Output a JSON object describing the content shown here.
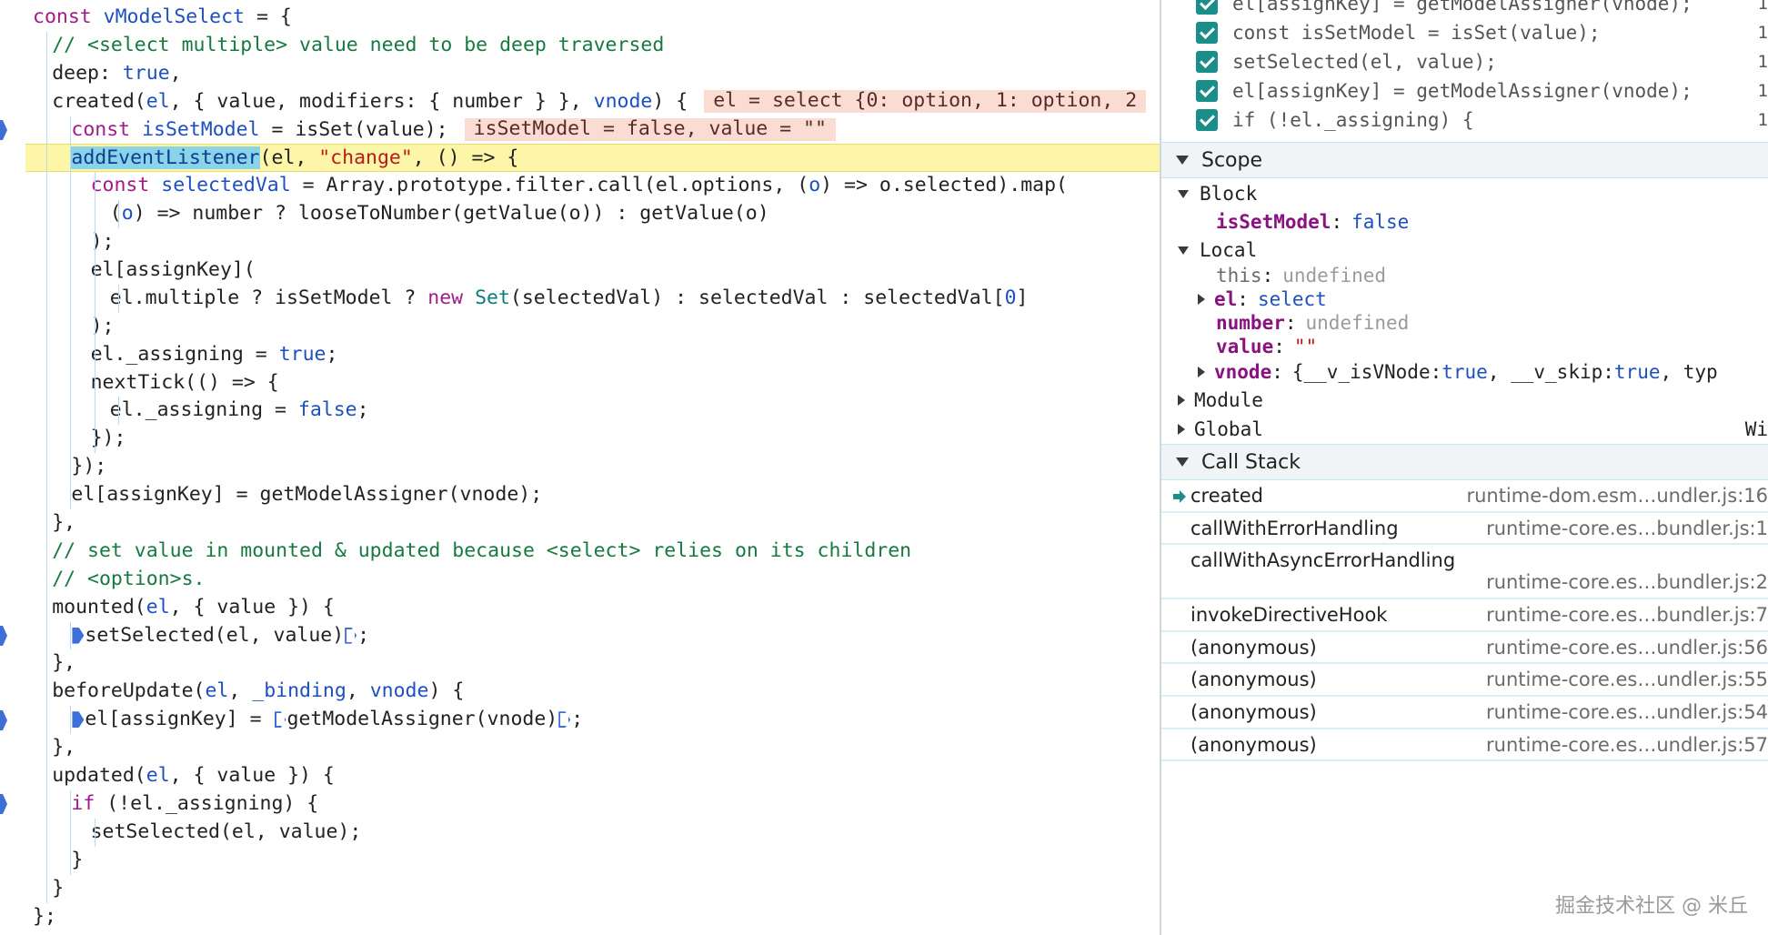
{
  "editor": {
    "lines": [
      {
        "indent": 0,
        "tokens": [
          {
            "t": "const ",
            "c": "kw"
          },
          {
            "t": "vModelSelect",
            "c": "param"
          },
          {
            "t": " = {",
            "c": "plain"
          }
        ]
      },
      {
        "indent": 1,
        "tokens": [
          {
            "t": "// <select multiple> value need to be deep traversed",
            "c": "comment"
          }
        ]
      },
      {
        "indent": 1,
        "tokens": [
          {
            "t": "deep: ",
            "c": "plain"
          },
          {
            "t": "true",
            "c": "lit"
          },
          {
            "t": ",",
            "c": "plain"
          }
        ]
      },
      {
        "indent": 1,
        "tokens": [
          {
            "t": "created(",
            "c": "plain"
          },
          {
            "t": "el",
            "c": "param"
          },
          {
            "t": ", { value, modifiers: { number } }, ",
            "c": "plain"
          },
          {
            "t": "vnode",
            "c": "param"
          },
          {
            "t": ") {",
            "c": "plain"
          }
        ],
        "inline": "el = select {0: option, 1: option, 2"
      },
      {
        "indent": 2,
        "tokens": [
          {
            "t": "const ",
            "c": "kw"
          },
          {
            "t": "isSetModel",
            "c": "param"
          },
          {
            "t": " = isSet(value);",
            "c": "plain"
          }
        ],
        "inline": "isSetModel = false, value = \"\""
      },
      {
        "indent": 2,
        "paused": true,
        "tokens": [
          {
            "t": "addEventListener",
            "c": "highlight"
          },
          {
            "t": "(el, ",
            "c": "plain"
          },
          {
            "t": "\"change\"",
            "c": "string"
          },
          {
            "t": ", () => {",
            "c": "plain"
          }
        ]
      },
      {
        "indent": 3,
        "tokens": [
          {
            "t": "const ",
            "c": "kw"
          },
          {
            "t": "selectedVal",
            "c": "param"
          },
          {
            "t": " = Array.prototype.filter.call(el.options, (",
            "c": "plain"
          },
          {
            "t": "o",
            "c": "param"
          },
          {
            "t": ") => o.selected).map(",
            "c": "plain"
          }
        ]
      },
      {
        "indent": 4,
        "tokens": [
          {
            "t": "(",
            "c": "plain"
          },
          {
            "t": "o",
            "c": "param"
          },
          {
            "t": ") => number ? looseToNumber(getValue(o)) : getValue(o)",
            "c": "plain"
          }
        ]
      },
      {
        "indent": 3,
        "tokens": [
          {
            "t": ");",
            "c": "plain"
          }
        ]
      },
      {
        "indent": 3,
        "tokens": [
          {
            "t": "el[assignKey](",
            "c": "plain"
          }
        ]
      },
      {
        "indent": 4,
        "tokens": [
          {
            "t": "el.multiple ? isSetModel ? ",
            "c": "plain"
          },
          {
            "t": "new ",
            "c": "kw"
          },
          {
            "t": "Set",
            "c": "cls"
          },
          {
            "t": "(selectedVal) : selectedVal : selectedVal[",
            "c": "plain"
          },
          {
            "t": "0",
            "c": "lit"
          },
          {
            "t": "]",
            "c": "plain"
          }
        ]
      },
      {
        "indent": 3,
        "tokens": [
          {
            "t": ");",
            "c": "plain"
          }
        ]
      },
      {
        "indent": 3,
        "tokens": [
          {
            "t": "el._assigning = ",
            "c": "plain"
          },
          {
            "t": "true",
            "c": "lit"
          },
          {
            "t": ";",
            "c": "plain"
          }
        ]
      },
      {
        "indent": 3,
        "tokens": [
          {
            "t": "nextTick(() => {",
            "c": "plain"
          }
        ]
      },
      {
        "indent": 4,
        "tokens": [
          {
            "t": "el._assigning = ",
            "c": "plain"
          },
          {
            "t": "false",
            "c": "lit"
          },
          {
            "t": ";",
            "c": "plain"
          }
        ]
      },
      {
        "indent": 3,
        "tokens": [
          {
            "t": "});",
            "c": "plain"
          }
        ]
      },
      {
        "indent": 2,
        "tokens": [
          {
            "t": "});",
            "c": "plain"
          }
        ]
      },
      {
        "indent": 2,
        "tokens": [
          {
            "t": "el[assignKey] = getModelAssigner(vnode);",
            "c": "plain"
          }
        ]
      },
      {
        "indent": 1,
        "tokens": [
          {
            "t": "},",
            "c": "plain"
          }
        ]
      },
      {
        "indent": 1,
        "tokens": [
          {
            "t": "// set value in mounted & updated because <select> relies on its children",
            "c": "comment"
          }
        ]
      },
      {
        "indent": 1,
        "tokens": [
          {
            "t": "// <option>s.",
            "c": "comment"
          }
        ]
      },
      {
        "indent": 1,
        "tokens": [
          {
            "t": "mounted(",
            "c": "plain"
          },
          {
            "t": "el",
            "c": "param"
          },
          {
            "t": ", { value }) {",
            "c": "plain"
          }
        ]
      },
      {
        "indent": 2,
        "tokens": [
          {
            "t": "",
            "c": "bpsolid"
          },
          {
            "t": "setSelected(el, value)",
            "c": "plain"
          },
          {
            "t": "",
            "c": "bpoutline"
          },
          {
            "t": ";",
            "c": "plain"
          }
        ]
      },
      {
        "indent": 1,
        "tokens": [
          {
            "t": "},",
            "c": "plain"
          }
        ]
      },
      {
        "indent": 1,
        "tokens": [
          {
            "t": "beforeUpdate(",
            "c": "plain"
          },
          {
            "t": "el",
            "c": "param"
          },
          {
            "t": ", ",
            "c": "plain"
          },
          {
            "t": "_binding",
            "c": "param"
          },
          {
            "t": ", ",
            "c": "plain"
          },
          {
            "t": "vnode",
            "c": "param"
          },
          {
            "t": ") {",
            "c": "plain"
          }
        ]
      },
      {
        "indent": 2,
        "tokens": [
          {
            "t": "",
            "c": "bpsolid"
          },
          {
            "t": "el[assignKey] = ",
            "c": "plain"
          },
          {
            "t": "",
            "c": "bpoutline"
          },
          {
            "t": "getModelAssigner(vnode)",
            "c": "plain"
          },
          {
            "t": "",
            "c": "bpoutline"
          },
          {
            "t": ";",
            "c": "plain"
          }
        ]
      },
      {
        "indent": 1,
        "tokens": [
          {
            "t": "},",
            "c": "plain"
          }
        ]
      },
      {
        "indent": 1,
        "tokens": [
          {
            "t": "updated(",
            "c": "plain"
          },
          {
            "t": "el",
            "c": "param"
          },
          {
            "t": ", { value }) {",
            "c": "plain"
          }
        ]
      },
      {
        "indent": 2,
        "tokens": [
          {
            "t": "if ",
            "c": "kw"
          },
          {
            "t": "(!el._assigning) {",
            "c": "plain"
          }
        ]
      },
      {
        "indent": 3,
        "tokens": [
          {
            "t": "setSelected(el, value);",
            "c": "plain"
          }
        ]
      },
      {
        "indent": 2,
        "tokens": [
          {
            "t": "}",
            "c": "plain"
          }
        ]
      },
      {
        "indent": 1,
        "tokens": [
          {
            "t": "}",
            "c": "plain"
          }
        ]
      },
      {
        "indent": 0,
        "tokens": [
          {
            "t": "};",
            "c": "plain"
          }
        ]
      }
    ]
  },
  "breakpoints": [
    {
      "text": "el[assignKey] = getModelAssigner(vnode);",
      "line": "1"
    },
    {
      "text": "const isSetModel = isSet(value);",
      "line": "1"
    },
    {
      "text": "setSelected(el, value);",
      "line": "1"
    },
    {
      "text": "el[assignKey] = getModelAssigner(vnode);",
      "line": "1"
    },
    {
      "text": "if (!el._assigning) {",
      "line": "1"
    }
  ],
  "scope": {
    "title": "Scope",
    "block": {
      "label": "Block",
      "vars": [
        {
          "name": "isSetModel",
          "value": "false"
        }
      ]
    },
    "local": {
      "label": "Local",
      "this_name": "this",
      "this_value": "undefined",
      "el_name": "el",
      "el_value": "select",
      "number_name": "number",
      "number_value": "undefined",
      "value_name": "value",
      "value_value": "\"\"",
      "vnode_name": "vnode",
      "vnode_value_a": "{__v_isVNode: ",
      "vnode_value_b": "true",
      "vnode_value_c": ", __v_skip: ",
      "vnode_value_d": "true",
      "vnode_value_e": ", typ"
    },
    "module": "Module",
    "global": "Global",
    "global_trailing": "Wi"
  },
  "call_stack": {
    "title": "Call Stack",
    "frames": [
      {
        "fn": "created",
        "loc": "runtime-dom.esm…undler.js:16",
        "current": true
      },
      {
        "fn": "callWithErrorHandling",
        "loc": "runtime-core.es…bundler.js:1"
      },
      {
        "fn": "callWithAsyncErrorHandling",
        "loc": "runtime-core.es…bundler.js:2",
        "wrap": true
      },
      {
        "fn": "invokeDirectiveHook",
        "loc": "runtime-core.es…bundler.js:7"
      },
      {
        "fn": "(anonymous)",
        "loc": "runtime-core.es…undler.js:56"
      },
      {
        "fn": "(anonymous)",
        "loc": "runtime-core.es…undler.js:55"
      },
      {
        "fn": "(anonymous)",
        "loc": "runtime-core.es…undler.js:54"
      },
      {
        "fn": "(anonymous)",
        "loc": "runtime-core.es…undler.js:57"
      }
    ]
  },
  "watermark": "掘金技术社区 @ 米丘",
  "colors": {
    "accent": "#1b8e8a",
    "paused_line": "#fdf5a8",
    "breakpoint": "#3d6fd6"
  }
}
